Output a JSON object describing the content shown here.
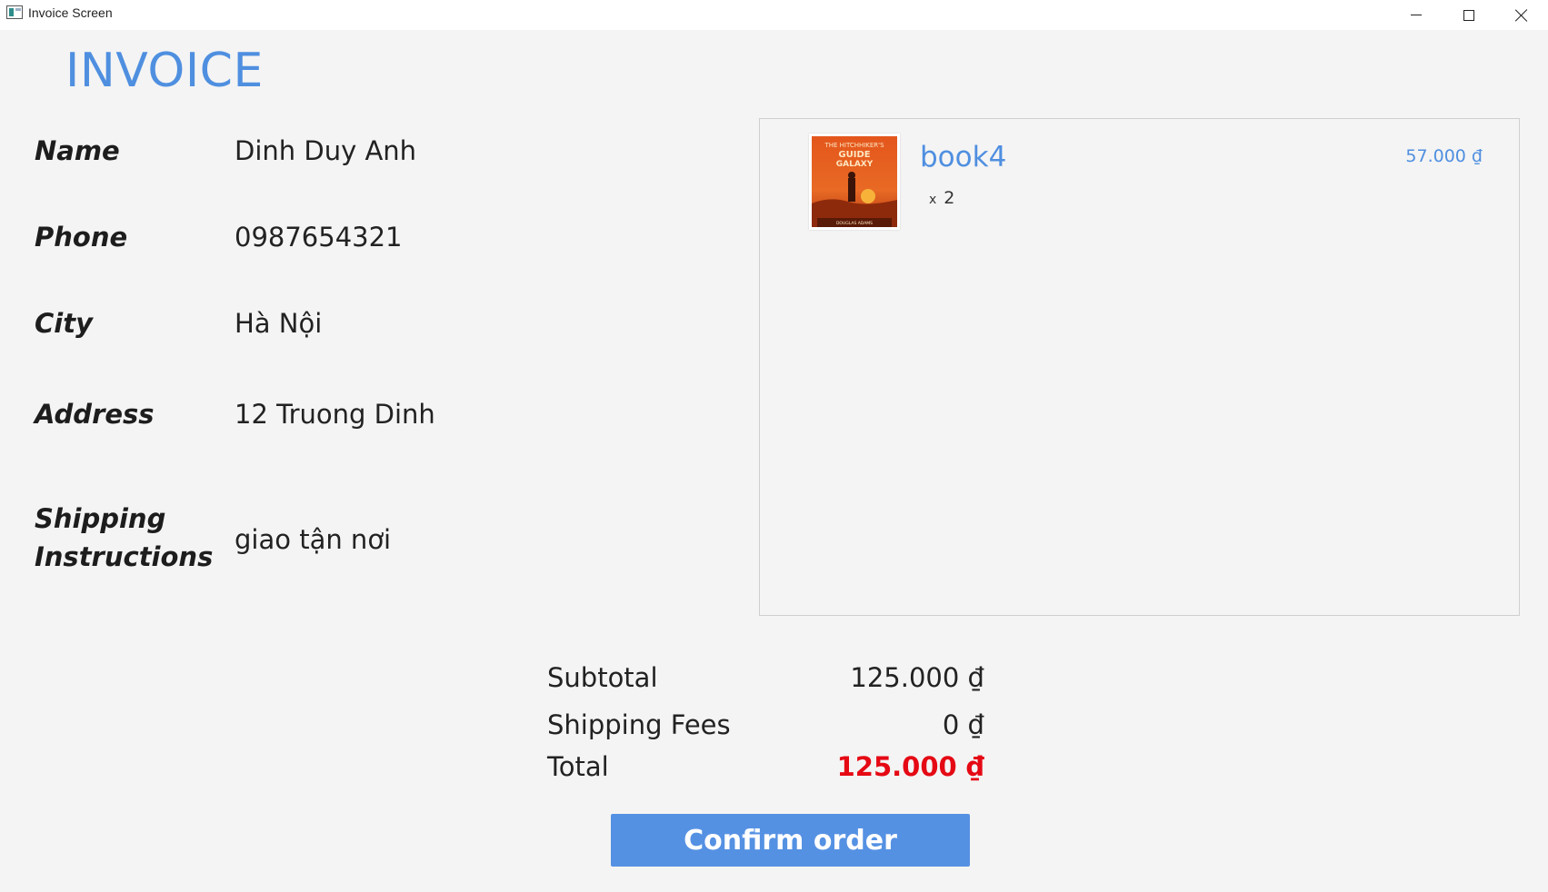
{
  "window": {
    "title": "Invoice Screen"
  },
  "page": {
    "heading": "INVOICE"
  },
  "customer": {
    "name_label": "Name",
    "name_value": "Dinh Duy Anh",
    "phone_label": "Phone",
    "phone_value": "0987654321",
    "city_label": "City",
    "city_value": "Hà Nội",
    "address_label": "Address",
    "address_value": "12 Truong Dinh",
    "shipping_label": "Shipping Instructions",
    "shipping_value": "giao tận nơi"
  },
  "cart": {
    "items": [
      {
        "name": "book4",
        "quantity_prefix": "x",
        "quantity": "2",
        "price": "57.000 ₫",
        "cover_text_top": "THE HITCHHIKER'S",
        "cover_text_mid": "GUIDE",
        "cover_text_bottom": "GALAXY",
        "cover_author": "DOUGLAS ADAMS"
      }
    ]
  },
  "totals": {
    "subtotal_label": "Subtotal",
    "subtotal_value": "125.000 ₫",
    "shipping_label": "Shipping Fees",
    "shipping_value": "0 ₫",
    "total_label": "Total",
    "total_value": "125.000 ₫"
  },
  "actions": {
    "confirm_label": "Confirm order"
  },
  "colors": {
    "accent": "#4f8fe0",
    "button": "#5591e3",
    "total_red": "#e50914",
    "cover_orange": "#e0541b"
  }
}
